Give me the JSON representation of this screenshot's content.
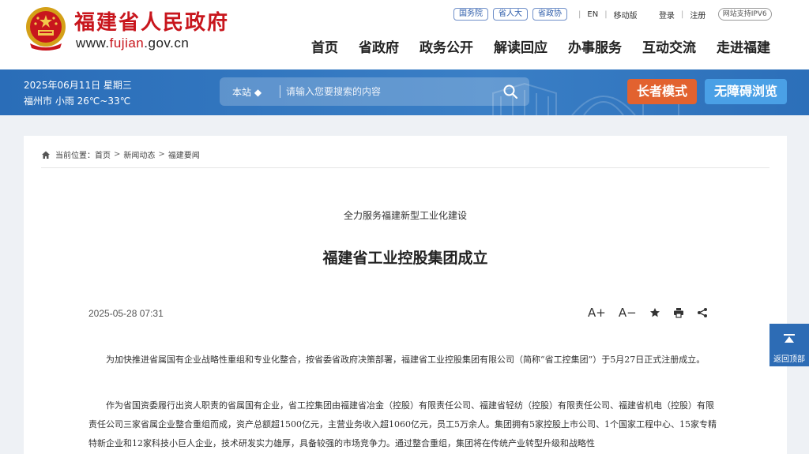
{
  "header": {
    "site_name": "福建省人民政府",
    "url_prefix": "www.",
    "url_brand": "fujian",
    "url_suffix": ".gov.cn",
    "top_pills": [
      "国务院",
      "省人大",
      "省政协"
    ],
    "top_links": {
      "en": "EN",
      "mobile": "移动版",
      "login": "登录",
      "register": "注册",
      "ipv6": "网站支持IPV6"
    },
    "nav": [
      "首页",
      "省政府",
      "政务公开",
      "解读回应",
      "办事服务",
      "互动交流",
      "走进福建"
    ]
  },
  "band": {
    "date": "2025年06月11日 星期三",
    "weather": "福州市 小雨 26℃~33℃",
    "search": {
      "scope": "本站 ◆",
      "placeholder": "请输入您要搜索的内容"
    },
    "elder_mode": "长者模式",
    "accessibility": "无障碍浏览"
  },
  "breadcrumb": {
    "label": "当前位置：",
    "items": [
      "首页",
      "新闻动态",
      "福建要闻"
    ]
  },
  "article": {
    "subtitle": "全力服务福建新型工业化建设",
    "title": "福建省工业控股集团成立",
    "date": "2025-05-28 07:31",
    "tools": {
      "font_up": "A+",
      "font_down": "A−"
    },
    "paragraphs": [
      "为加快推进省属国有企业战略性重组和专业化整合，按省委省政府决策部署，福建省工业控股集团有限公司（简称“省工控集团”）于5月27日正式注册成立。",
      "作为省国资委履行出资人职责的省属国有企业，省工控集团由福建省冶金（控股）有限责任公司、福建省轻纺（控股）有限责任公司、福建省机电（控股）有限责任公司三家省属企业整合重组而成，资产总额超1500亿元，主营业务收入超1060亿元，员工5万余人。集团拥有5家控股上市公司、1个国家工程中心、15家专精特新企业和12家科技小巨人企业，技术研发实力雄厚，具备较强的市场竞争力。通过整合重组，集团将在传统产业转型升级和战略性"
    ]
  },
  "back_to_top": "返回顶部",
  "colors": {
    "brand_red": "#c8161d",
    "band_blue": "#3a7fc6",
    "elder_orange": "#e2622f",
    "access_blue": "#4aa0e6"
  }
}
